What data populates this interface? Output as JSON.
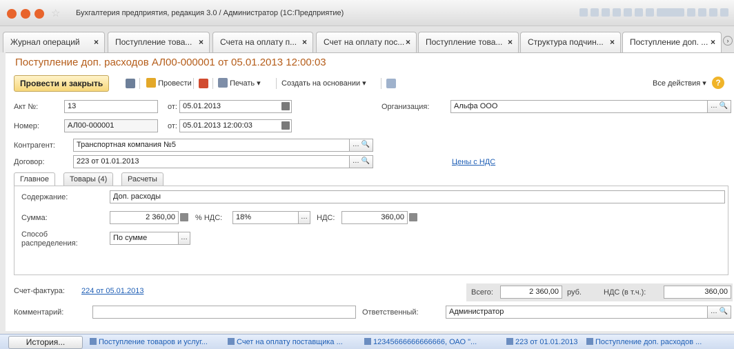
{
  "window": {
    "title": "Бухгалтерия предприятия, редакция 3.0 / Администратор  (1С:Предприятие)"
  },
  "tabs": [
    {
      "label": "Журнал операций",
      "close": "×"
    },
    {
      "label": "Поступление това...",
      "close": "×"
    },
    {
      "label": "Счета на оплату п...",
      "close": "×"
    },
    {
      "label": "Счет на оплату пос...",
      "close": "×"
    },
    {
      "label": "Поступление това...",
      "close": "×"
    },
    {
      "label": "Структура подчин...",
      "close": "×"
    },
    {
      "label": "Поступление доп. ...",
      "close": "×"
    }
  ],
  "document": {
    "title": "Поступление доп. расходов АЛ00-000001 от 05.01.2013 12:00:03"
  },
  "toolbar": {
    "post_close": "Провести и закрыть",
    "post": "Провести",
    "print": "Печать ▾",
    "create_based": "Создать на основании ▾",
    "all_actions": "Все действия ▾",
    "help": "?"
  },
  "header": {
    "act_label": "Акт №:",
    "act_value": "13",
    "from_label": "от:",
    "act_date": "05.01.2013",
    "number_label": "Номер:",
    "number_value": "АЛ00-000001",
    "from_label2": "от:",
    "number_date": "05.01.2013 12:00:03",
    "org_label": "Организация:",
    "org_value": "Альфа ООО",
    "counterparty_label": "Контрагент:",
    "counterparty_value": "Транспортная компания №5",
    "contract_label": "Договор:",
    "contract_value": "223 от 01.01.2013",
    "prices_link": "Цены с НДС"
  },
  "inner_tabs": [
    {
      "label": "Главное"
    },
    {
      "label": "Товары (4)"
    },
    {
      "label": "Расчеты"
    }
  ],
  "main_tab": {
    "content_label": "Содержание:",
    "content_value": "Доп. расходы",
    "sum_label": "Сумма:",
    "sum_value": "2 360,00",
    "vat_rate_label": "% НДС:",
    "vat_rate_value": "18%",
    "vat_label": "НДС:",
    "vat_value": "360,00",
    "distribution_label": "Способ распределения:",
    "distribution_value": "По сумме"
  },
  "footer": {
    "invoice_label": "Счет-фактура:",
    "invoice_link": "224 от 05.01.2013",
    "total_label": "Всего:",
    "total_value": "2 360,00",
    "currency": "руб.",
    "vat_incl_label": "НДС (в т.ч.):",
    "vat_incl_value": "360,00",
    "comment_label": "Комментарий:",
    "comment_value": "",
    "responsible_label": "Ответственный:",
    "responsible_value": "Администратор"
  },
  "statusbar": {
    "history": "История...",
    "items": [
      "Поступление товаров и услуг...",
      "Счет на оплату поставщика ...",
      "12345666666666666, ОАО \"...",
      "223 от 01.01.2013",
      "Поступление доп. расходов ..."
    ]
  },
  "colors": {
    "title_orange": "#b55d1a",
    "link_blue": "#1e5eb5",
    "primary_button": "#f7d77a"
  }
}
